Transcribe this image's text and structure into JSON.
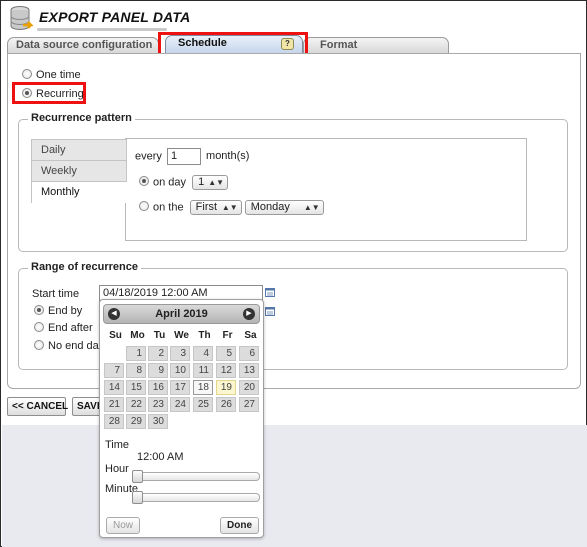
{
  "header": {
    "title": "EXPORT PANEL DATA"
  },
  "tabs": {
    "data_source": "Data source configuration",
    "schedule": "Schedule",
    "schedule_badge": "?",
    "format": "Format"
  },
  "schedule_type": {
    "one_time": "One time",
    "recurring": "Recurring",
    "selected": "Recurring"
  },
  "recurrence_pattern": {
    "legend": "Recurrence pattern",
    "tabs": [
      "Daily",
      "Weekly",
      "Monthly"
    ],
    "active_tab": "Monthly",
    "every_label": "every",
    "every_value": "1",
    "every_unit": "month(s)",
    "on_day_label": "on day",
    "on_day_value": "1",
    "on_the_label": "on the",
    "on_the_ordinal": "First",
    "on_the_weekday": "Monday"
  },
  "range": {
    "legend": "Range of recurrence",
    "start_label": "Start time",
    "start_value": "04/18/2019 12:00 AM",
    "end_by": "End by",
    "end_after": "End after",
    "no_end": "No end date"
  },
  "buttons": {
    "cancel": "<< CANCEL",
    "save": "SAVE"
  },
  "calendar": {
    "month_label": "April 2019",
    "dow": [
      "Su",
      "Mo",
      "Tu",
      "We",
      "Th",
      "Fr",
      "Sa"
    ],
    "weeks": [
      [
        "",
        "1",
        "2",
        "3",
        "4",
        "5",
        "6"
      ],
      [
        "7",
        "8",
        "9",
        "10",
        "11",
        "12",
        "13"
      ],
      [
        "14",
        "15",
        "16",
        "17",
        "18",
        "19",
        "20"
      ],
      [
        "21",
        "22",
        "23",
        "24",
        "25",
        "26",
        "27"
      ],
      [
        "28",
        "29",
        "30",
        "",
        "",
        "",
        ""
      ]
    ],
    "selected_day": "18",
    "today_day": "19",
    "time_label": "Time",
    "time_value": "12:00 AM",
    "hour_label": "Hour",
    "minute_label": "Minute",
    "hour_level": 0,
    "minute_level": 0,
    "now_button": "Now",
    "done_button": "Done"
  }
}
